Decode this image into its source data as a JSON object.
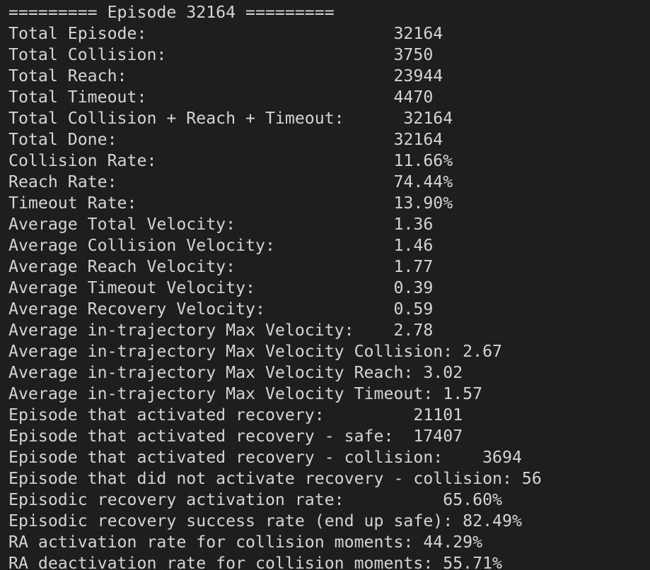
{
  "terminal": {
    "lines": [
      "========= Episode 32164 =========",
      "Total Episode:                         32164",
      "Total Collision:                       3750",
      "Total Reach:                           23944",
      "Total Timeout:                         4470",
      "Total Collision + Reach + Timeout:      32164",
      "Total Done:                            32164",
      "Collision Rate:                        11.66%",
      "Reach Rate:                            74.44%",
      "Timeout Rate:                          13.90%",
      "Average Total Velocity:                1.36",
      "Average Collision Velocity:            1.46",
      "Average Reach Velocity:                1.77",
      "Average Timeout Velocity:              0.39",
      "Average Recovery Velocity:             0.59",
      "Average in-trajectory Max Velocity:    2.78",
      "Average in-trajectory Max Velocity Collision: 2.67",
      "Average in-trajectory Max Velocity Reach: 3.02",
      "Average in-trajectory Max Velocity Timeout: 1.57",
      "Episode that activated recovery:         21101",
      "Episode that activated recovery - safe:  17407",
      "Episode that activated recovery - collision:    3694",
      "Episode that did not activate recovery - collision: 56",
      "Episodic recovery activation rate:          65.60%",
      "Episodic recovery success rate (end up safe): 82.49%",
      "RA activation rate for collision moments: 44.29%",
      "RA deactivation rate for collision moments: 55.71%"
    ]
  }
}
